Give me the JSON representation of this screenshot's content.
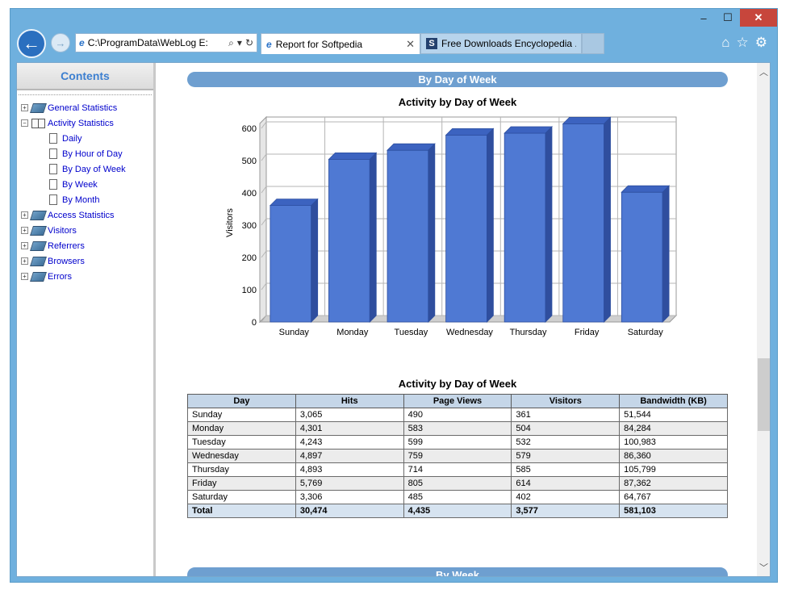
{
  "window": {
    "controls": {
      "minimize": "–",
      "maximize": "☐",
      "close": "✕"
    }
  },
  "toolbar": {
    "back_icon": "←",
    "forward_icon": "→",
    "address": "C:\\ProgramData\\WebLog E:",
    "address_tools": [
      "⌕",
      "▾",
      "↻"
    ],
    "tabs": [
      {
        "title": "Report for Softpedia",
        "icon": "e",
        "close": "✕"
      },
      {
        "title": "Free Downloads Encyclopedia ...",
        "icon": "S"
      }
    ],
    "right_icons": [
      "⌂",
      "☆",
      "⚙"
    ]
  },
  "sidebar": {
    "title": "Contents",
    "items": [
      {
        "label": "General Statistics",
        "level": 0,
        "expander": "+",
        "icon": "closed-book"
      },
      {
        "label": "Activity Statistics",
        "level": 0,
        "expander": "−",
        "icon": "open-book"
      },
      {
        "label": "Daily",
        "level": 1,
        "icon": "page"
      },
      {
        "label": "By Hour of Day",
        "level": 1,
        "icon": "page"
      },
      {
        "label": "By Day of Week",
        "level": 1,
        "icon": "page"
      },
      {
        "label": "By Week",
        "level": 1,
        "icon": "page"
      },
      {
        "label": "By Month",
        "level": 1,
        "icon": "page"
      },
      {
        "label": "Access Statistics",
        "level": 0,
        "expander": "+",
        "icon": "closed-book"
      },
      {
        "label": "Visitors",
        "level": 0,
        "expander": "+",
        "icon": "closed-book"
      },
      {
        "label": "Referrers",
        "level": 0,
        "expander": "+",
        "icon": "closed-book"
      },
      {
        "label": "Browsers",
        "level": 0,
        "expander": "+",
        "icon": "closed-book"
      },
      {
        "label": "Errors",
        "level": 0,
        "expander": "+",
        "icon": "closed-book"
      }
    ]
  },
  "main": {
    "section_title": "By Day of Week",
    "chart_title": "Activity by Day of Week",
    "table_title": "Activity by Day of Week",
    "next_section_title": "By Week",
    "table": {
      "headers": [
        "Day",
        "Hits",
        "Page Views",
        "Visitors",
        "Bandwidth (KB)"
      ],
      "rows": [
        [
          "Sunday",
          "3,065",
          "490",
          "361",
          "51,544"
        ],
        [
          "Monday",
          "4,301",
          "583",
          "504",
          "84,284"
        ],
        [
          "Tuesday",
          "4,243",
          "599",
          "532",
          "100,983"
        ],
        [
          "Wednesday",
          "4,897",
          "759",
          "579",
          "86,360"
        ],
        [
          "Thursday",
          "4,893",
          "714",
          "585",
          "105,799"
        ],
        [
          "Friday",
          "5,769",
          "805",
          "614",
          "87,362"
        ],
        [
          "Saturday",
          "3,306",
          "485",
          "402",
          "64,767"
        ]
      ],
      "total": [
        "Total",
        "30,474",
        "4,435",
        "3,577",
        "581,103"
      ]
    }
  },
  "chart_data": {
    "type": "bar",
    "title": "Activity by Day of Week",
    "categories": [
      "Sunday",
      "Monday",
      "Tuesday",
      "Wednesday",
      "Thursday",
      "Friday",
      "Saturday"
    ],
    "values": [
      361,
      504,
      532,
      579,
      585,
      614,
      402
    ],
    "xlabel": "",
    "ylabel": "Visitors",
    "ylim": [
      0,
      600
    ],
    "yticks": [
      0,
      100,
      200,
      300,
      400,
      500,
      600
    ],
    "grid": true,
    "bar_color": "#4f79d3"
  },
  "scrollbar": {
    "up": "︿",
    "down": "﹀"
  }
}
